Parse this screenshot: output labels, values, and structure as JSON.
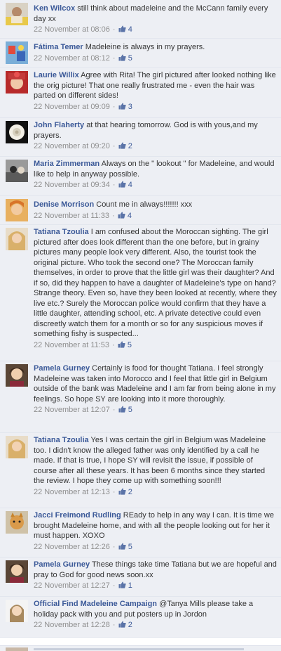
{
  "comments": [
    {
      "author": "Ken Wilcox",
      "text": "still think about madeleine and the McCann family every day xx",
      "date": "22 November at 08:06",
      "likes": "4"
    },
    {
      "author": "Fátima Temer",
      "text": "Madeleine is always in my prayers.",
      "date": "22 November at 08:12",
      "likes": "5"
    },
    {
      "author": "Laurie Willix",
      "text": "Agree with Rita! The girl pictured after looked nothing like the orig picture! That one really frustrated me - even the hair was parted on different sides!",
      "date": "22 November at 09:09",
      "likes": "3"
    },
    {
      "author": "John Flaherty",
      "text": "at that hearing tomorrow. God is with yous,and my prayers.",
      "date": "22 November at 09:20",
      "likes": "2"
    },
    {
      "author": "Maria Zimmerman",
      "text": "Always on the \" lookout \" for Madeleine, and would like to help in anyway possible.",
      "date": "22 November at 09:34",
      "likes": "4"
    },
    {
      "author": "Denise Morrison",
      "text": "Count me in always!!!!!!! xxx",
      "date": "22 November at 11:33",
      "likes": "4"
    },
    {
      "author": "Tatiana Tzoulia",
      "text": "I am confused about the Moroccan sighting. The girl pictured after does look different than the one before, but in grainy pictures many people look very different. Also, the tourist took the original picture. Who took the second one? The Moroccan family themselves, in order to prove that the little girl was their daughter? And if so, did they happen to have a daughter of Madeleine's type on hand? Strange theory. Even so, have they been looked at recently, where they live etc.? Surely the Moroccan police would confirm that they have a little daughter, attending school, etc. A private detective could even discreetly watch them for a month or so for any suspicious moves if something fishy is suspected...",
      "date": "22 November at 11:53",
      "likes": "5"
    },
    {
      "author": "Pamela Gurney",
      "text": "Certainly is food for thought Tatiana. I feel strongly Madeleine was taken into Morocco and I feel that little girl in Belgium outside of the bank was Madeleine and I am far from being alone in my feelings. So hope SY are looking into it more thoroughly.",
      "date": "22 November at 12:07",
      "likes": "5"
    },
    {
      "author": "Tatiana Tzoulia",
      "text": "Yes I was certain the girl in Belgium was Madeleine too. I didn't know the alleged father was only identified by a call he made. If that is true, I hope SY will revisit the issue, if possible of course after all these years. It has been 6 months since they started the review. I hope they come up with something soon!!!",
      "date": "22 November at 12:13",
      "likes": "2"
    },
    {
      "author": "Jacci Freimond Rudling",
      "text": "REady to help in any way I can. It is time we brought Madeleine home, and with all the people looking out for her it must happen. XOXO",
      "date": "22 November at 12:26",
      "likes": "5"
    },
    {
      "author": "Pamela Gurney",
      "text": "These things take time Tatiana but we are hopeful and pray to God for good news soon.xx",
      "date": "22 November at 12:27",
      "likes": "1"
    },
    {
      "author": "Official Find Madeleine Campaign",
      "text": "@Tanya Mills please take a holiday pack with you and put posters up in Jordon",
      "date": "22 November at 12:28",
      "likes": "2"
    }
  ],
  "separator": "·",
  "colors": {
    "background": "#edeff4",
    "link": "#3b5998",
    "meta": "#8f8f8f"
  }
}
